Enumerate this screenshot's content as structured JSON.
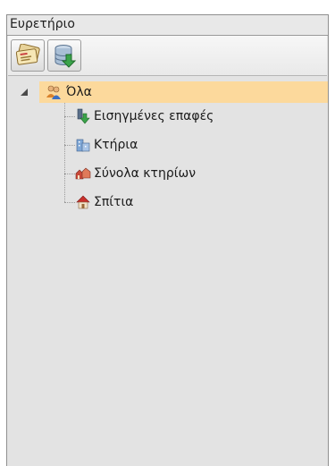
{
  "panel": {
    "title": "Ευρετήριο"
  },
  "toolbar": {
    "buttons": [
      {
        "icon": "address-cards-icon"
      },
      {
        "icon": "database-import-icon"
      }
    ]
  },
  "tree": {
    "root": {
      "label": "Όλα",
      "icon": "people-icon",
      "expanded": true,
      "selected": true
    },
    "children": [
      {
        "label": "Εισηγμένες επαφές",
        "icon": "imported-contacts-icon"
      },
      {
        "label": "Κτήρια",
        "icon": "buildings-icon"
      },
      {
        "label": "Σύνολα κτηρίων",
        "icon": "building-sets-icon"
      },
      {
        "label": "Σπίτια",
        "icon": "house-icon"
      }
    ]
  },
  "colors": {
    "selection": "#fcd99c",
    "panel_background": "#e3e3e3",
    "border": "#8f8f8f"
  }
}
